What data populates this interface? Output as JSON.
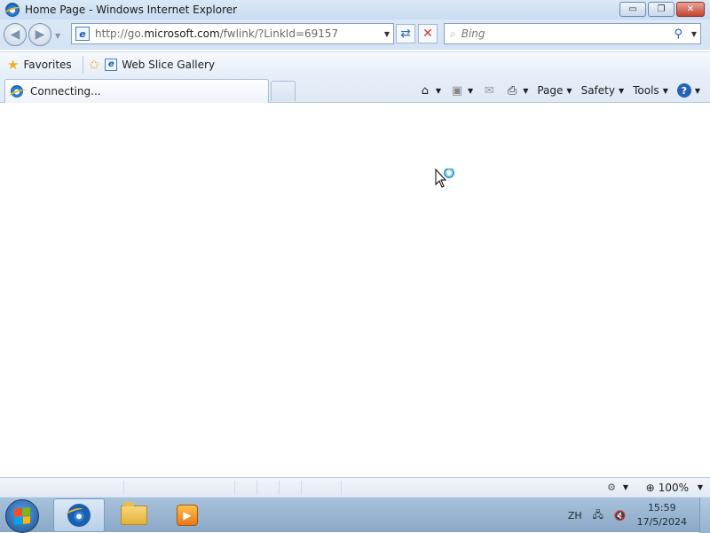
{
  "window": {
    "title": "Home Page - Windows Internet Explorer",
    "controls": {
      "minimize": "▭",
      "maximize": "❐",
      "close": "✕"
    }
  },
  "navigation": {
    "back_icon": "back-arrow-icon",
    "forward_icon": "forward-arrow-icon",
    "address_prefix": "http://go.",
    "address_domain": "microsoft.com",
    "address_path": "/fwlink/?LinkId=69157",
    "search_placeholder": "Bing"
  },
  "favorites_bar": {
    "favorites_label": "Favorites",
    "web_slice_label": "Web Slice Gallery"
  },
  "tabs": [
    {
      "label": "Connecting...",
      "active": true
    }
  ],
  "command_bar": {
    "page": "Page",
    "safety": "Safety",
    "tools": "Tools"
  },
  "status_bar": {
    "zoom": "100%"
  },
  "taskbar": {
    "language": "ZH",
    "time": "15:59",
    "date": "17/5/2024"
  },
  "colors": {
    "chrome": "#d3e3f5",
    "accent": "#1a5fb0",
    "stop": "#d0342c"
  }
}
